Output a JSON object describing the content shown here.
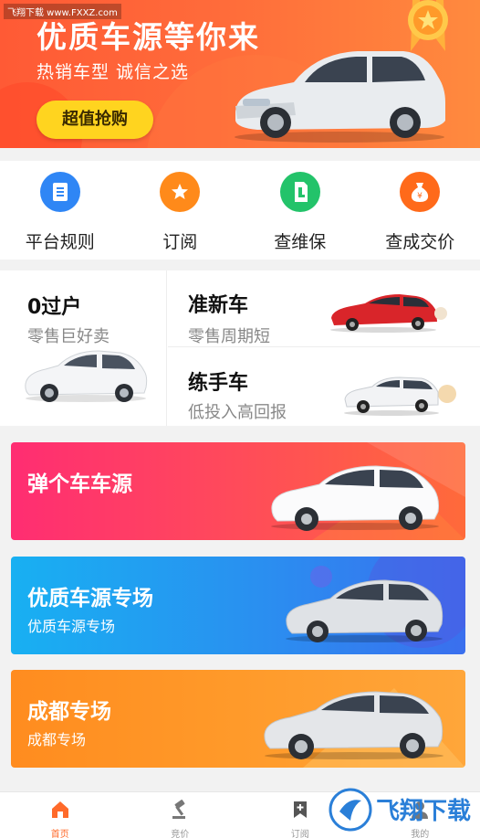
{
  "watermark": "飞翔下载 www.FXXZ.com",
  "banner": {
    "title": "优质车源等你来",
    "subtitle": "热销车型 诚信之选",
    "cta": "超值抢购"
  },
  "quick_menu": [
    {
      "label": "平台规则",
      "icon": "document-icon",
      "color": "#2f86f5"
    },
    {
      "label": "订阅",
      "icon": "star-icon",
      "color": "#ff8a1a"
    },
    {
      "label": "查维保",
      "icon": "phone-check-icon",
      "color": "#23c36a"
    },
    {
      "label": "查成交价",
      "icon": "money-bag-icon",
      "color": "#ff6a1a"
    }
  ],
  "promo": {
    "left": {
      "title": "0过户",
      "subtitle": "零售巨好卖"
    },
    "right_top": {
      "title": "准新车",
      "subtitle": "零售周期短"
    },
    "right_bottom": {
      "title": "练手车",
      "subtitle": "低投入高回报"
    }
  },
  "cards": [
    {
      "title": "弹个车车源",
      "subtitle": ""
    },
    {
      "title": "优质车源专场",
      "subtitle": "优质车源专场"
    },
    {
      "title": "成都专场",
      "subtitle": "成都专场"
    }
  ],
  "nav": [
    {
      "label": "首页",
      "active": true
    },
    {
      "label": "竞价",
      "active": false
    },
    {
      "label": "订阅",
      "active": false
    },
    {
      "label": "我的",
      "active": false
    }
  ],
  "logo_watermark": "飞翔下载"
}
